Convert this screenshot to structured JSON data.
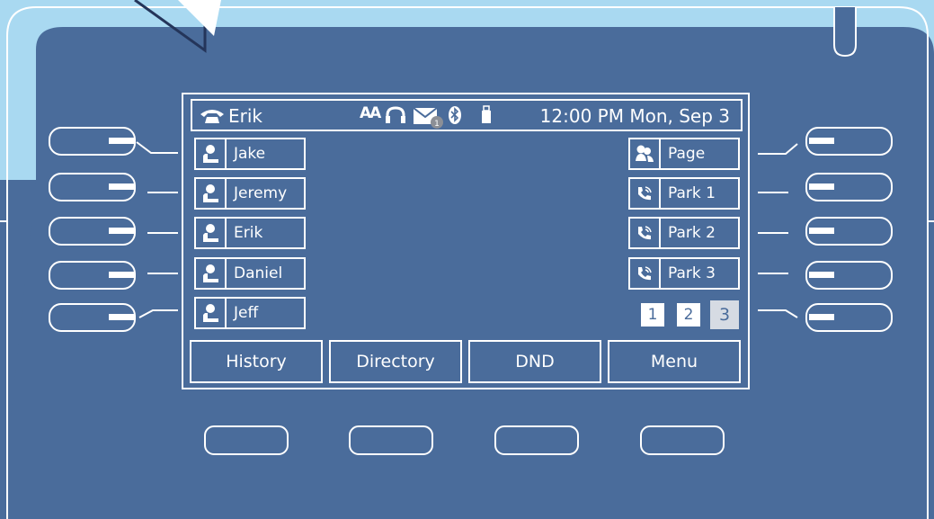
{
  "status": {
    "user": "Erik",
    "clock": "12:00 PM Mon, Sep 3",
    "mail_badge": "1",
    "icons": [
      "phone-handset-icon",
      "font-size-icon",
      "headset-icon",
      "mail-icon",
      "bluetooth-icon",
      "usb-icon"
    ]
  },
  "left_keys": [
    {
      "label": "Jake",
      "icon": "person-icon"
    },
    {
      "label": "Jeremy",
      "icon": "person-icon"
    },
    {
      "label": "Erik",
      "icon": "person-icon"
    },
    {
      "label": "Daniel",
      "icon": "person-icon"
    },
    {
      "label": "Jeff",
      "icon": "person-icon"
    }
  ],
  "right_keys": [
    {
      "label": "Page",
      "icon": "page-group-icon"
    },
    {
      "label": "Park 1",
      "icon": "park-call-icon"
    },
    {
      "label": "Park 2",
      "icon": "park-call-icon"
    },
    {
      "label": "Park 3",
      "icon": "park-call-icon"
    }
  ],
  "pages": {
    "labels": [
      "1",
      "2",
      "3"
    ],
    "active": "3"
  },
  "softkeys": [
    "History",
    "Directory",
    "DND",
    "Menu"
  ],
  "colors": {
    "body": "#4a6c9b",
    "backdrop": "#a9d9f1",
    "line": "#ffffff"
  }
}
